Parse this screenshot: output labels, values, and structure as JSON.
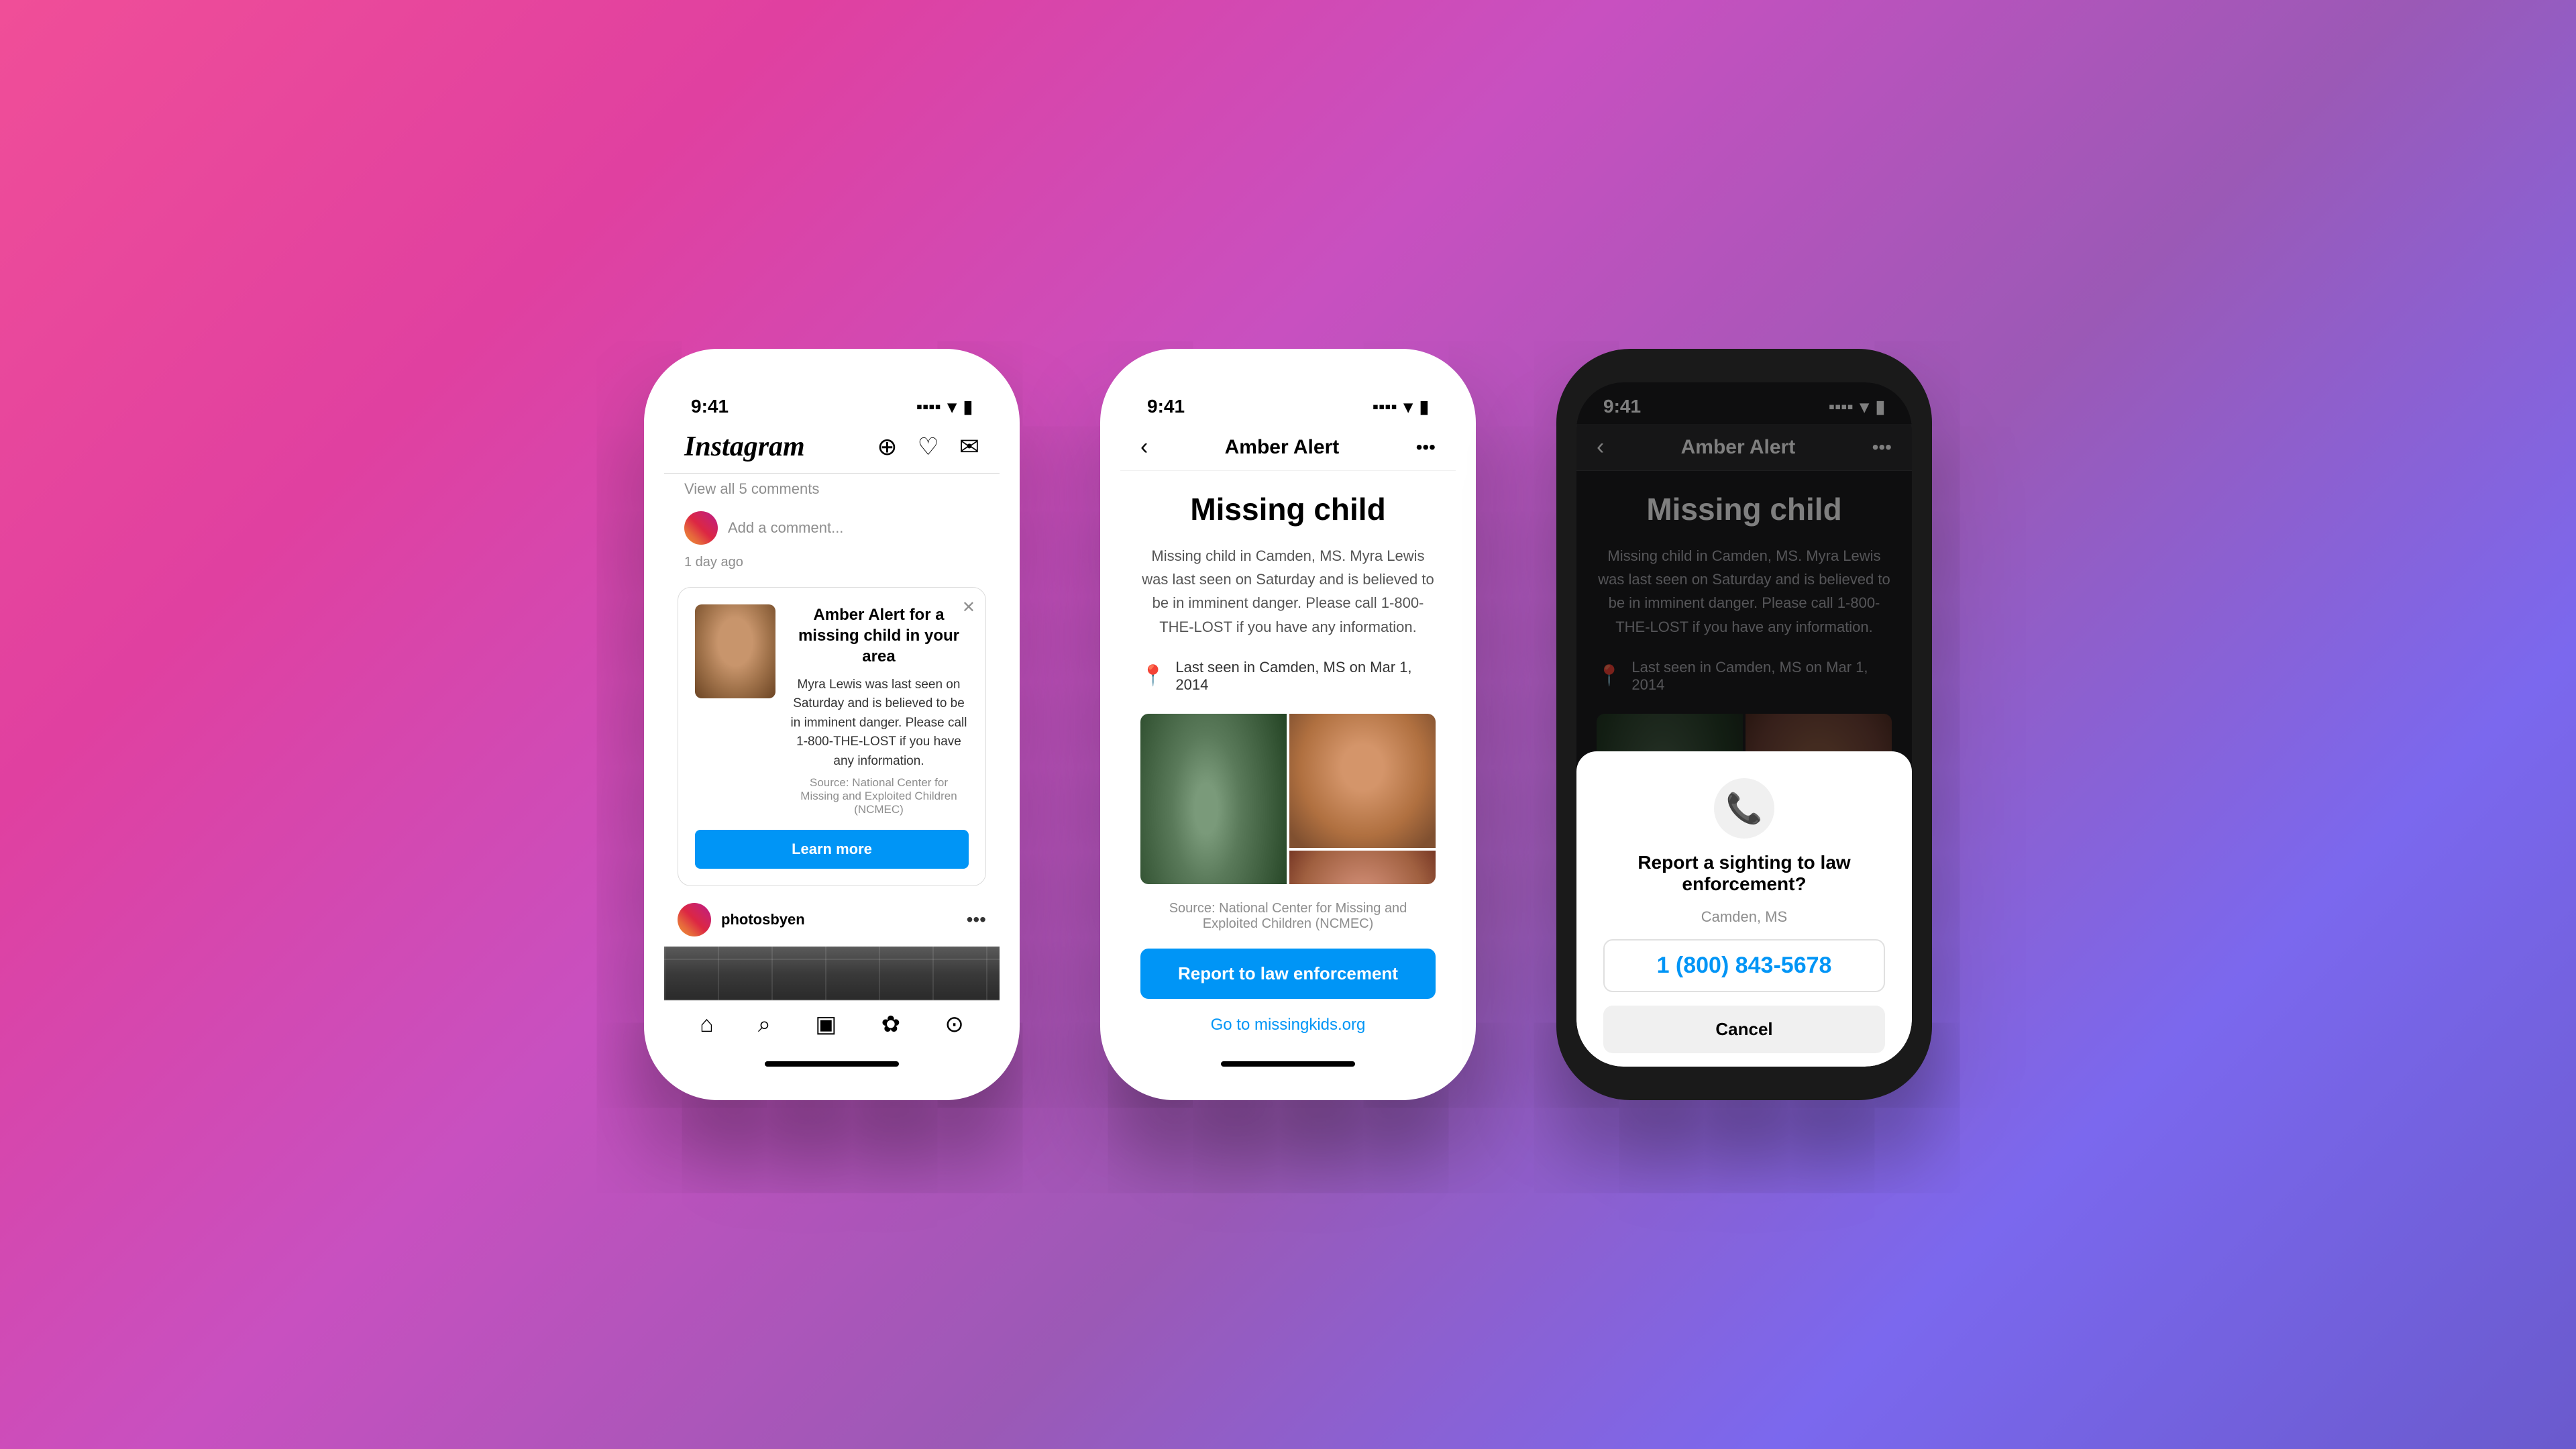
{
  "background": {
    "gradient": "linear-gradient(135deg, #f04e98, #c850c0, #7b68ee)"
  },
  "phone1": {
    "status_time": "9:41",
    "instagram_logo": "Instagram",
    "view_comments": "View all 5 comments",
    "add_comment_placeholder": "Add a comment...",
    "time_ago": "1 day ago",
    "amber_card": {
      "title": "Amber Alert for a missing child in your area",
      "description": "Myra Lewis was last seen on Saturday and is believed to be in imminent danger. Please call 1-800-THE-LOST if you have any information.",
      "source": "Source: National Center for Missing and Exploited Children (NCMEC)",
      "learn_more_label": "Learn more"
    },
    "post_username": "photosbyen",
    "nav_icons": [
      "🏠",
      "🔍",
      "📺",
      "🛍",
      "👤"
    ]
  },
  "phone2": {
    "status_time": "9:41",
    "header_title": "Amber Alert",
    "missing_title": "Missing child",
    "missing_description": "Missing child in Camden, MS. Myra Lewis was last seen on Saturday and is believed to be in imminent danger. Please call 1-800-THE-LOST if you have any information.",
    "location_text": "Last seen in Camden, MS on Mar 1, 2014",
    "source_text": "Source: National Center for Missing and Exploited Children (NCMEC)",
    "report_btn_label": "Report to law enforcement",
    "missingkids_link": "Go to missingkids.org"
  },
  "phone3": {
    "status_time": "9:41",
    "header_title": "Amber Alert",
    "missing_title": "Missing child",
    "missing_description": "Missing child in Camden, MS. Myra Lewis was last seen on Saturday and is believed to be in imminent danger. Please call 1-800-THE-LOST if you have any information.",
    "location_text": "Last seen in Camden, MS on Mar 1, 2014",
    "modal": {
      "report_title": "Report a sighting to law enforcement?",
      "modal_location": "Camden, MS",
      "phone_number": "1 (800) 843-5678",
      "cancel_label": "Cancel"
    }
  }
}
